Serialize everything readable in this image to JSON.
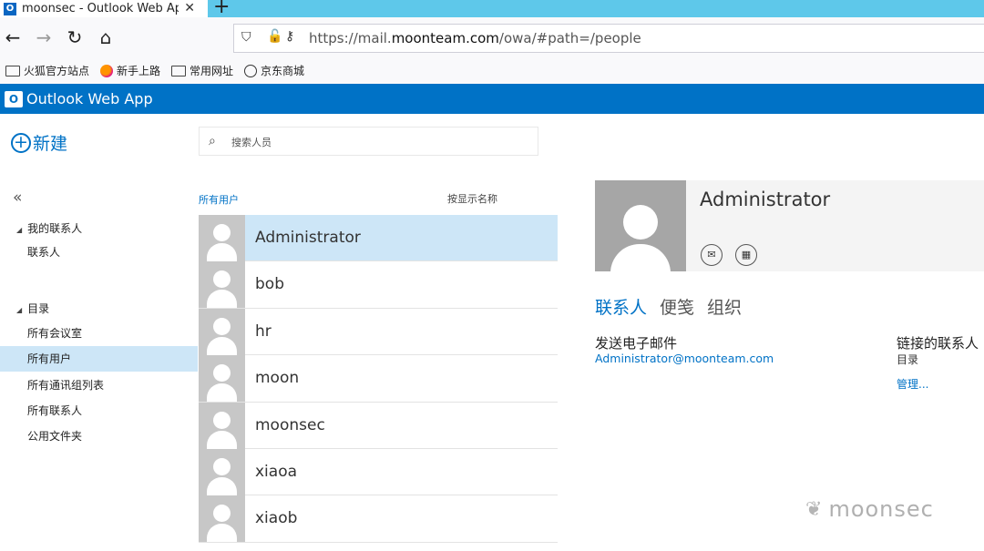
{
  "browser": {
    "tab_title": "moonsec - Outlook Web App",
    "tab_close": "✕",
    "new_tab": "+",
    "url_prefix": "https://mail.",
    "url_domain": "moonteam.com",
    "url_suffix": "/owa/#path=/people",
    "bookmarks": [
      {
        "label": "火狐官方站点",
        "icon": "folder-icon"
      },
      {
        "label": "新手上路",
        "icon": "firefox-icon"
      },
      {
        "label": "常用网址",
        "icon": "folder-icon"
      },
      {
        "label": "京东商城",
        "icon": "globe-icon"
      }
    ]
  },
  "owa": {
    "app_title": "Outlook Web App",
    "new_label": "新建",
    "search_placeholder": "搜索人员"
  },
  "nav": {
    "collapse": "«",
    "my_contacts_head": "我的联系人",
    "contacts": "联系人",
    "directory_head": "目录",
    "items": [
      "所有会议室",
      "所有用户",
      "所有通讯组列表",
      "所有联系人",
      "公用文件夹"
    ],
    "selected": "所有用户"
  },
  "list": {
    "filter": "所有用户",
    "sort": "按显示名称",
    "people": [
      "Administrator",
      "bob",
      "hr",
      "moon",
      "moonsec",
      "xiaoa",
      "xiaob"
    ],
    "selected": "Administrator"
  },
  "detail": {
    "name": "Administrator",
    "tabs": [
      "联系人",
      "便笺",
      "组织"
    ],
    "send_email_label": "发送电子邮件",
    "email": "Administrator@moonteam.com",
    "linked_label": "链接的联系人",
    "linked_sub": "目录",
    "manage": "管理..."
  },
  "watermark": "moonsec",
  "colors": {
    "owa_blue": "#0072c6",
    "selection": "#cde6f7",
    "tab_strip": "#5ec8ea"
  }
}
